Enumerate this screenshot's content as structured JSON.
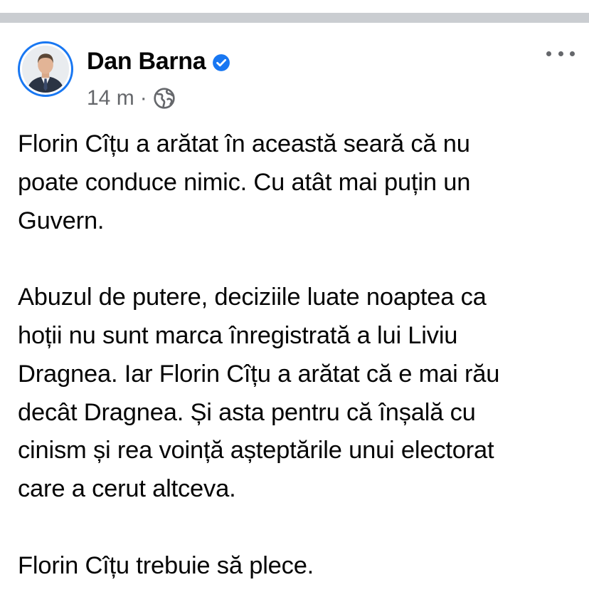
{
  "post": {
    "author": {
      "name": "Dan Barna",
      "verified": true,
      "avatar": "profile-photo"
    },
    "meta": {
      "time": "14 m",
      "separator": "·",
      "audience_icon": "globe-icon"
    },
    "more_icon": "ellipsis-icon",
    "paragraphs": [
      "Florin Cîțu a arătat în această seară că nu\npoate conduce nimic. Cu atât mai puțin un\nGuvern.",
      "Abuzul de putere, deciziile luate noaptea ca\nhoții nu sunt marca înregistrată a lui Liviu\nDragnea. Iar Florin Cîțu a arătat că e mai rău\ndecât Dragnea. Și asta pentru că înșală cu\ncinism și rea voință așteptările unui electorat\ncare a cerut altceva.",
      "Florin Cîțu trebuie să plece."
    ]
  },
  "colors": {
    "accent": "#1877f2",
    "secondary_text": "#65676b",
    "divider": "#cacdd1"
  }
}
